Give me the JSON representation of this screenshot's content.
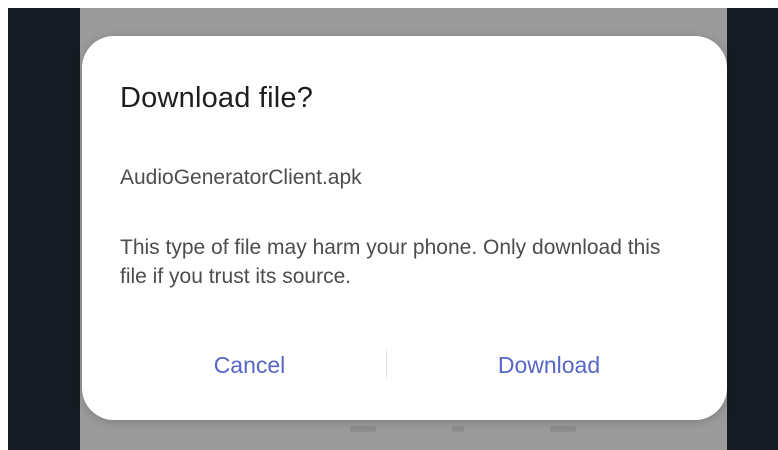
{
  "dialog": {
    "title": "Download file?",
    "file_name": "AudioGeneratorClient.apk",
    "warning": "This type of file may harm your phone. Only download this file if you trust its source.",
    "cancel_label": "Cancel",
    "download_label": "Download"
  },
  "colors": {
    "accent": "#5766c9",
    "dialog_background": "#ffffff",
    "scrim": "#9b9b9b",
    "outer_background": "#151b22"
  }
}
